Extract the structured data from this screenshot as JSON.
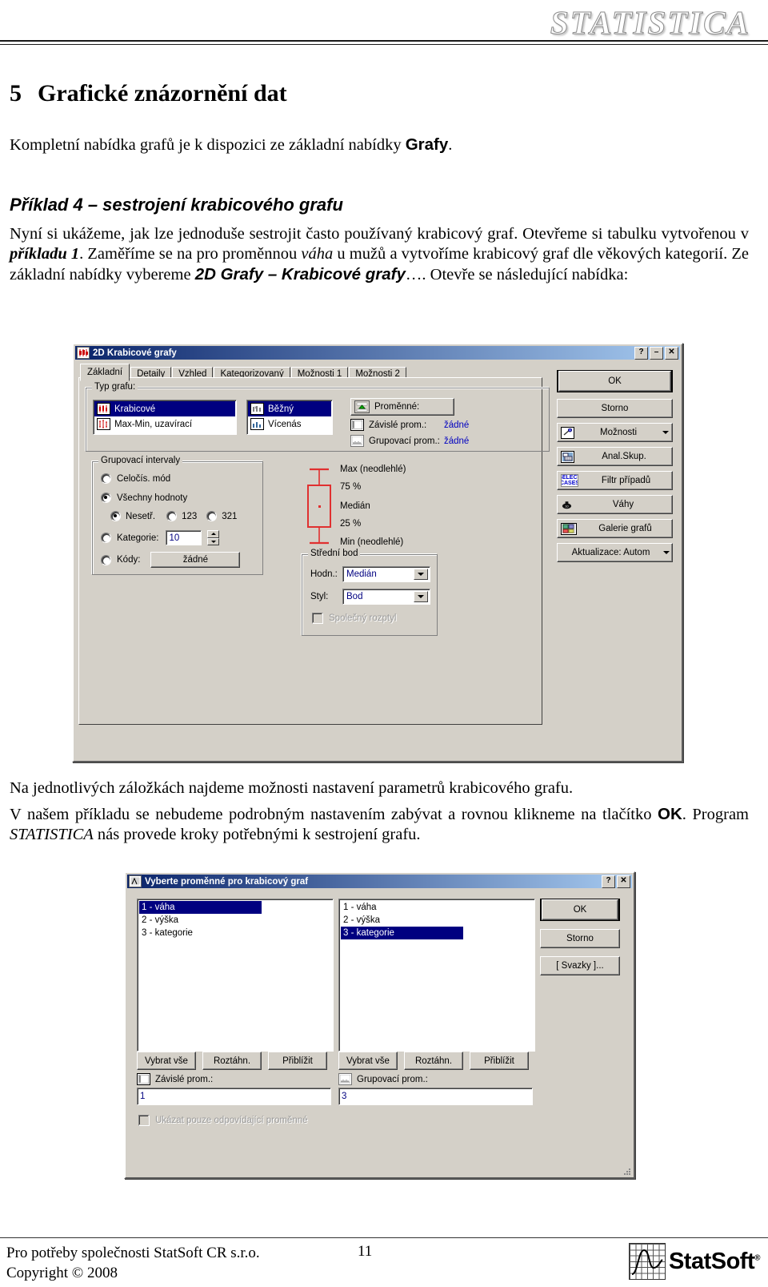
{
  "header": {
    "logo": "STATISTICA"
  },
  "document": {
    "chapter_number": "5",
    "chapter_title": "Grafické znázornění dat",
    "intro_1": "Kompletní nabídka grafů je k dispozici ze základní nabídky ",
    "intro_menu": "Grafy",
    "intro_end": ".",
    "example_heading": "Příklad 4 – sestrojení krabicového grafu",
    "body_1": "Nyní si ukážeme, jak lze jednoduše sestrojit často používaný krabicový graf. Otevřeme si tabulku vytvořenou v ",
    "body_ref1": "příkladu 1",
    "body_2": ". Zaměříme se na pro proměnnou ",
    "body_var": "váha",
    "body_3": " u mužů a vytvoříme krabicový graf dle věkových kategorií. Ze základní nabídky vybereme ",
    "body_menu": "2D Grafy – Krabicové grafy",
    "body_4": "…. Otevře se následující nabídka:",
    "mid_1": "Na jednotlivých záložkách najdeme možnosti nastavení parametrů krabicového grafu.",
    "mid_2": "V našem příkladu se nebudeme podrobným nastavením zabývat a rovnou klikneme na tlačítko ",
    "mid_ok": "OK",
    "mid_3": ". Program ",
    "mid_app": "STATISTICA",
    "mid_4": " nás provede kroky potřebnými k sestrojení grafu."
  },
  "dialog1": {
    "title": "2D Krabicové grafy",
    "title_icon": "boxplot-icon",
    "titlebar_buttons": [
      "?",
      "–",
      "✕"
    ],
    "tabs": [
      {
        "label": "Základní",
        "active": true
      },
      {
        "label": "Detaily",
        "active": false
      },
      {
        "label": "Vzhled",
        "active": false
      },
      {
        "label": "Kategorizovaný",
        "active": false
      },
      {
        "label": "Možnosti 1",
        "active": false
      },
      {
        "label": "Možnosti 2",
        "active": false
      }
    ],
    "graph_type": {
      "label": "Typ grafu:",
      "list1": [
        {
          "label": "Krabicové",
          "selected": true
        },
        {
          "label": "Max-Min, uzavírací",
          "selected": false
        }
      ],
      "list2": [
        {
          "label": "Běžný",
          "selected": true
        },
        {
          "label": "Vícenás",
          "selected": false
        }
      ]
    },
    "variables": {
      "button": "Proměnné:",
      "dependent_label": "Závislé prom.:",
      "dependent_value": "žádné",
      "grouping_label": "Grupovací prom.:",
      "grouping_value": "žádné"
    },
    "grouping_intervals": {
      "label": "Grupovací intervaly",
      "opt_integer": "Celočís. mód",
      "opt_all": "Všechny hodnoty",
      "sub_unsorted": "Nesetř.",
      "sub_123": "123",
      "sub_321": "321",
      "opt_categories": "Kategorie:",
      "categories_value": "10",
      "opt_codes": "Kódy:",
      "codes_value": "žádné",
      "selected": "Všechny hodnoty",
      "sub_selected": "Nesetř."
    },
    "boxplot_legend": {
      "max": "Max (neodlehlé)",
      "q75": "75 %",
      "median": "Medián",
      "q25": "25 %",
      "min": "Min (neodlehlé)",
      "color": "#e03030"
    },
    "mid_point": {
      "label": "Střední bod",
      "value_label": "Hodn.:",
      "value": "Medián",
      "style_label": "Styl:",
      "style": "Bod",
      "pooled_label": "Společný rozptyl",
      "pooled_checked": false,
      "pooled_disabled": true
    },
    "buttons": [
      {
        "label": "OK",
        "icon": null,
        "default": true
      },
      {
        "label": "Storno",
        "icon": null,
        "default": false
      },
      {
        "label": "Možnosti",
        "icon": "options-icon",
        "dropdown": true
      },
      {
        "label": "Anal.Skup.",
        "icon": "group-analysis-icon"
      },
      {
        "label": "Filtr případů",
        "icon": "select-cases-icon"
      },
      {
        "label": "Váhy",
        "icon": "weights-icon"
      },
      {
        "label": "Galerie grafů",
        "icon": "graph-gallery-icon"
      },
      {
        "label": "Aktualizace: Autom",
        "icon": null,
        "dropdown": true
      }
    ]
  },
  "dialog2": {
    "title": "Vyberte proměnné pro krabicový graf",
    "title_icon": "variables-icon",
    "titlebar_buttons": [
      "?",
      "✕"
    ],
    "left_list": [
      {
        "label": "1 - váha",
        "selected": true
      },
      {
        "label": "2 - výška",
        "selected": false
      },
      {
        "label": "3 - kategorie",
        "selected": false
      }
    ],
    "right_list": [
      {
        "label": "1 - váha",
        "selected": false
      },
      {
        "label": "2 - výška",
        "selected": false
      },
      {
        "label": "3 - kategorie",
        "selected": true
      }
    ],
    "list_buttons": [
      "Vybrat vše",
      "Roztáhn.",
      "Přiblížit"
    ],
    "left_field_label": "Závislé prom.:",
    "left_field_value": "1",
    "right_field_label": "Grupovací prom.:",
    "right_field_value": "3",
    "checkbox_label": "Ukázat pouze odpovídající proměnné",
    "checkbox_checked": false,
    "checkbox_disabled": true,
    "buttons": [
      {
        "label": "OK",
        "default": true
      },
      {
        "label": "Storno",
        "default": false
      },
      {
        "label": "[ Svazky ]...",
        "default": false
      }
    ]
  },
  "footer": {
    "line1": "Pro potřeby společnosti StatSoft CR s.r.o.",
    "line2": "Copyright © 2008",
    "page_number": "11",
    "logo_text": "StatSoft",
    "logo_sup": "®"
  }
}
